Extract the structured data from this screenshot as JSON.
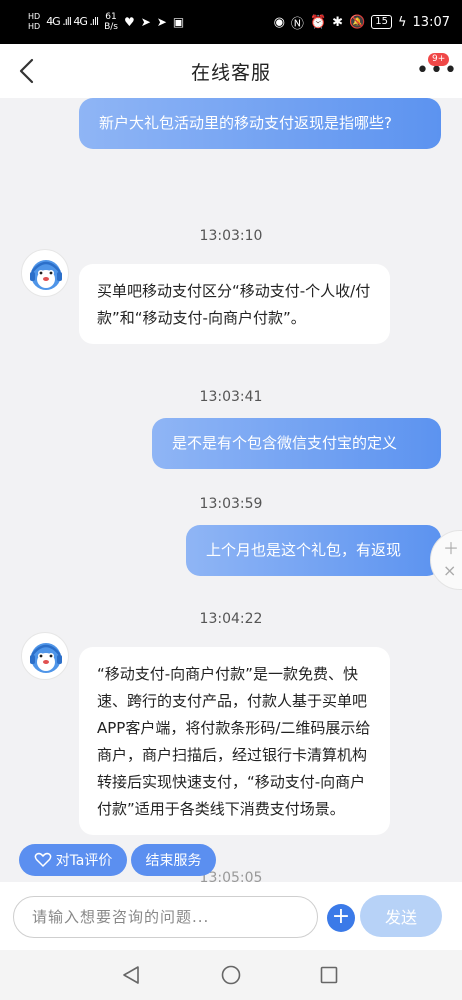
{
  "status_bar": {
    "net_left": "HD",
    "signal": "4G .ıll 4G .ıll",
    "net_speed_value": "61",
    "net_speed_unit": "B/s",
    "battery": "15",
    "time": "13:07"
  },
  "header": {
    "title": "在线客服",
    "badge": "9+"
  },
  "messages": [
    {
      "type": "out",
      "text": "新户大礼包活动里的移动支付返现是指哪些?"
    },
    {
      "type": "time",
      "text": "13:03:10"
    },
    {
      "type": "in",
      "text": "买单吧移动支付区分“移动支付-个人收/付款”和“移动支付-向商户付款”。"
    },
    {
      "type": "time",
      "text": "13:03:41"
    },
    {
      "type": "out",
      "text": "是不是有个包含微信支付宝的定义"
    },
    {
      "type": "time",
      "text": "13:03:59"
    },
    {
      "type": "out",
      "text": "上个月也是这个礼包，有返现"
    },
    {
      "type": "time",
      "text": "13:04:22"
    },
    {
      "type": "in",
      "text": "“移动支付-向商户付款”是一款免费、快速、跨行的支付产品，付款人基于买单吧APP客户端，将付款条形码/二维码展示给商户，商户扫描后，经过银行卡清算机构转接后实现快速支付，“移动支付-向商户付款”适用于各类线下消费支付场景。"
    },
    {
      "type": "time",
      "text": "13:05:05"
    }
  ],
  "quick_actions": {
    "rate": "对Ta评价",
    "end": "结束服务"
  },
  "input": {
    "placeholder": "请输入想要咨询的问题...",
    "value": "",
    "send_label": "发送"
  },
  "colors": {
    "accent": "#5b8ff0",
    "out_bubble_start": "#8fb5f5",
    "out_bubble_end": "#5c93f0",
    "badge": "#f04848"
  }
}
